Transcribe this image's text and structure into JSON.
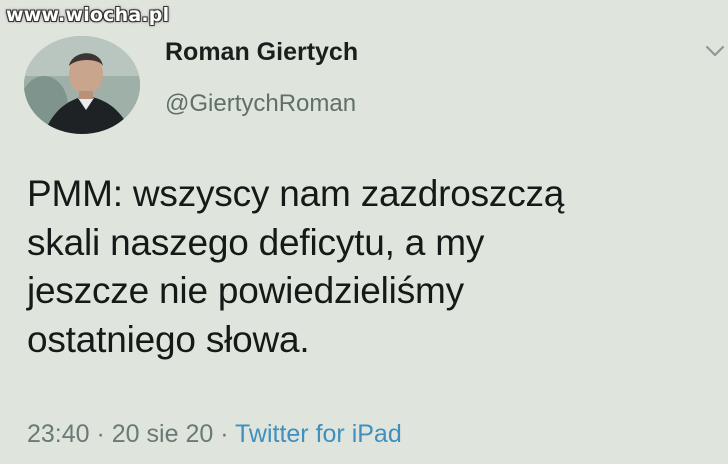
{
  "watermark": "www.wiocha.pl",
  "author": {
    "name": "Roman Giertych",
    "handle": "@GiertychRoman"
  },
  "tweet": {
    "lines": [
      "PMM: wszyscy nam zazdroszczą",
      "skali naszego deficytu, a my",
      "jeszcze nie powiedzieliśmy",
      "ostatniego słowa."
    ],
    "time": "23:40",
    "separator1": " · ",
    "date": "20 sie 20",
    "separator2": " · ",
    "source": "Twitter for iPad"
  },
  "icons": {
    "menu": "chevron-down-icon"
  },
  "colors": {
    "background": "#dfe5dc",
    "link": "#3f8fbf",
    "muted": "#6a7a75"
  }
}
